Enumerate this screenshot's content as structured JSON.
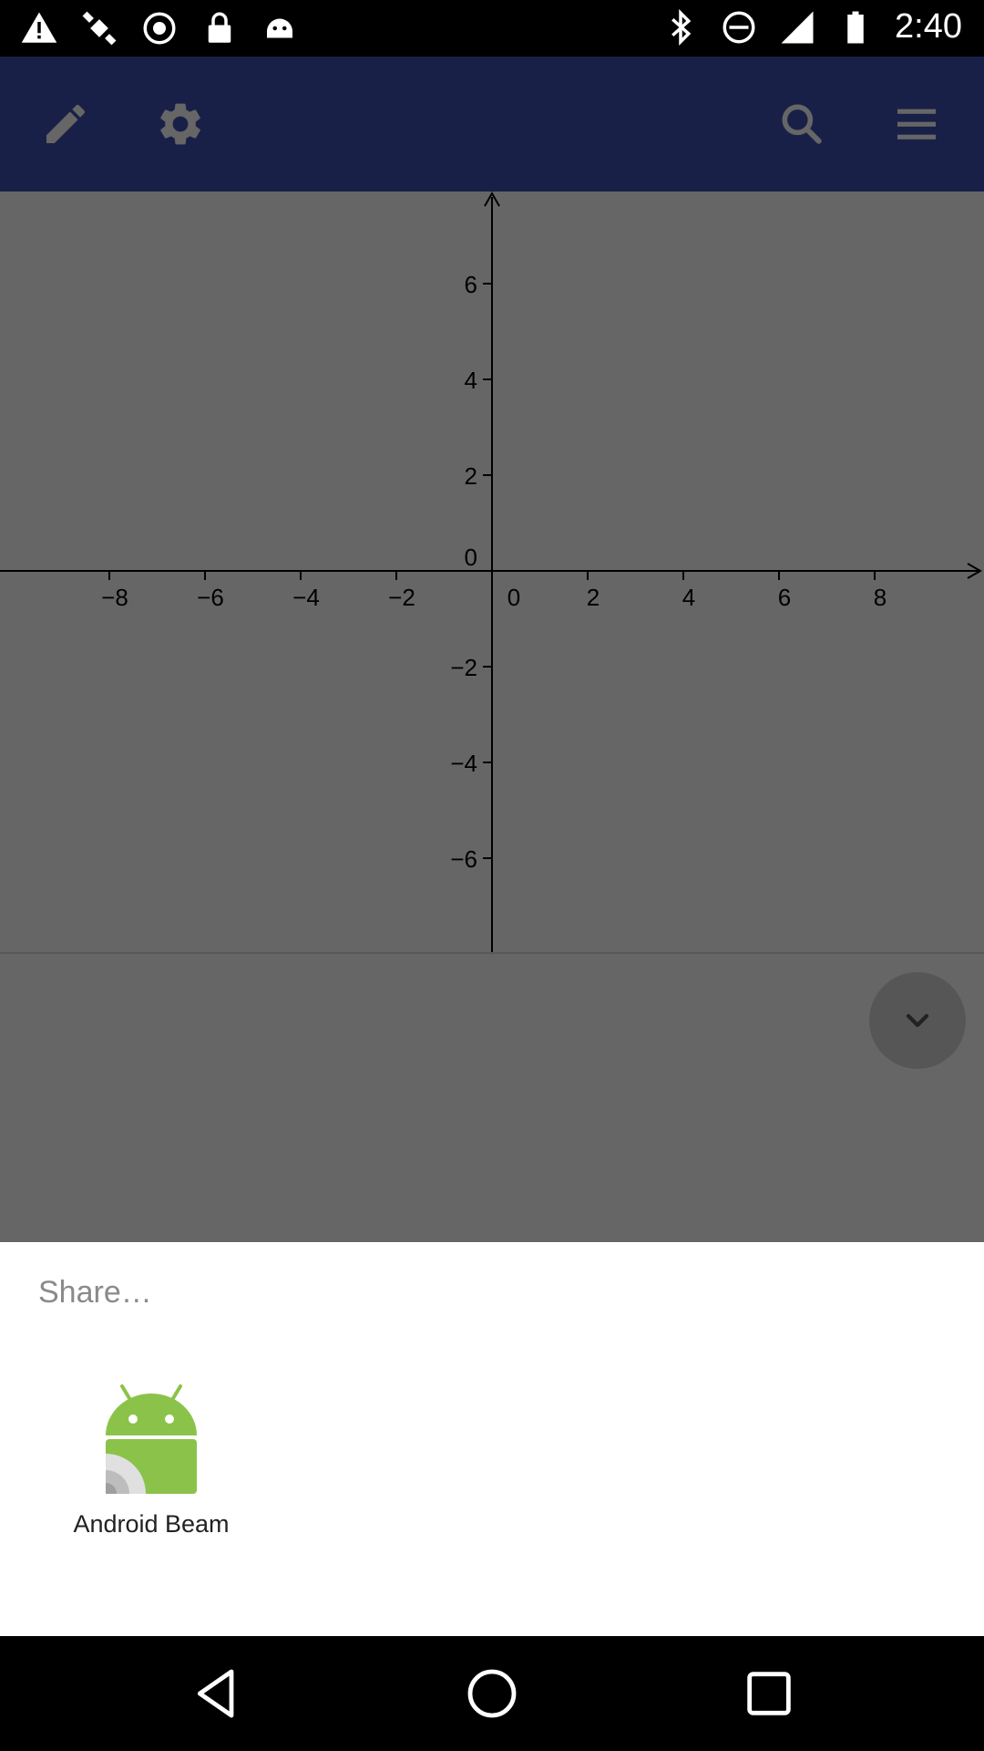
{
  "status_bar": {
    "time": "2:40",
    "left_icons": [
      "warning-icon",
      "fake-gps-satellite-icon",
      "sync-icon",
      "lock-icon",
      "android-debug-icon"
    ],
    "right_icons": [
      "bluetooth-icon",
      "do-not-disturb-icon",
      "signal-icon",
      "battery-icon"
    ]
  },
  "toolbar": {
    "left_buttons": [
      "edit-pencil-icon",
      "settings-gear-icon"
    ],
    "right_buttons": [
      "search-icon",
      "overflow-menu-icon"
    ],
    "color": "#3f51b5"
  },
  "graph": {
    "x_ticks": [
      "−8",
      "−6",
      "−4",
      "−2",
      "0",
      "2",
      "4",
      "6",
      "8"
    ],
    "y_ticks_positive": [
      "6",
      "4",
      "2",
      "0"
    ],
    "y_ticks_negative": [
      "−2",
      "−4",
      "−6"
    ]
  },
  "share_sheet": {
    "title": "Share…",
    "targets": [
      {
        "label": "Android Beam",
        "icon": "android-beam-icon",
        "accent": "#8bc34a"
      }
    ]
  },
  "nav_bar": {
    "buttons": [
      "back-icon",
      "home-icon",
      "recents-icon"
    ]
  }
}
